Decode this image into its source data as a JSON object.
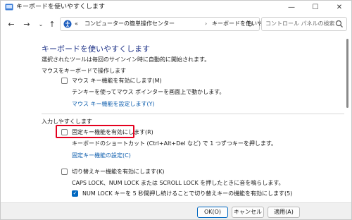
{
  "window": {
    "title": "キーボードを使いやすくします"
  },
  "titlebar_controls": {
    "minimize": "—",
    "maximize": "☐",
    "close": "✕"
  },
  "nav": {
    "back": "←",
    "forward": "→",
    "dropdown": "⌄",
    "up": "↑"
  },
  "address": {
    "overflow": "«",
    "crumbs": [
      "コンピューターの簡単操作センター",
      "キーボードを使いやすくします"
    ],
    "separator": "›",
    "dropdown": "⌄"
  },
  "refresh": "↻",
  "search": {
    "placeholder": "コントロール パネルの検索"
  },
  "main": {
    "title": "キーボードを使いやすくします",
    "subtitle": "選択されたツールは毎回のサインイン時に自動的に開始されます。"
  },
  "mouse_group": {
    "heading": "マウスをキーボードで操作します",
    "checkbox_label": "マウス キー機能を有効にします(M)",
    "checked": false,
    "description": "テンキーを使ってマウス ポインターを画面上で動かします。",
    "link": "マウス キー機能を設定します(Y)"
  },
  "typing_group": {
    "heading": "入力しやすくします",
    "sticky_label": "固定キー機能を有効にします(R)",
    "sticky_checked": false,
    "sticky_description": "キーボードのショートカット (Ctrl+Alt+Del など) で 1 つずつキーを押します。",
    "sticky_link": "固定キー機能の設定(C)",
    "toggle_label": "切り替えキー機能を有効にします(K)",
    "toggle_checked": false,
    "toggle_description": "CAPS LOCK、NUM LOCK または SCROLL LOCK を押したときに音を鳴らします。",
    "numlock_label": "NUM LOCK キーを 5 秒間押し続けることで切り替えキーの機能を有効にします(5)",
    "numlock_checked": true
  },
  "buttons": {
    "ok": "OK(O)",
    "cancel": "キャンセル",
    "apply": "適用(A)"
  },
  "colors": {
    "accent": "#0067c0",
    "link": "#0b5cad",
    "title": "#1e3287",
    "highlight": "#e4001e"
  }
}
